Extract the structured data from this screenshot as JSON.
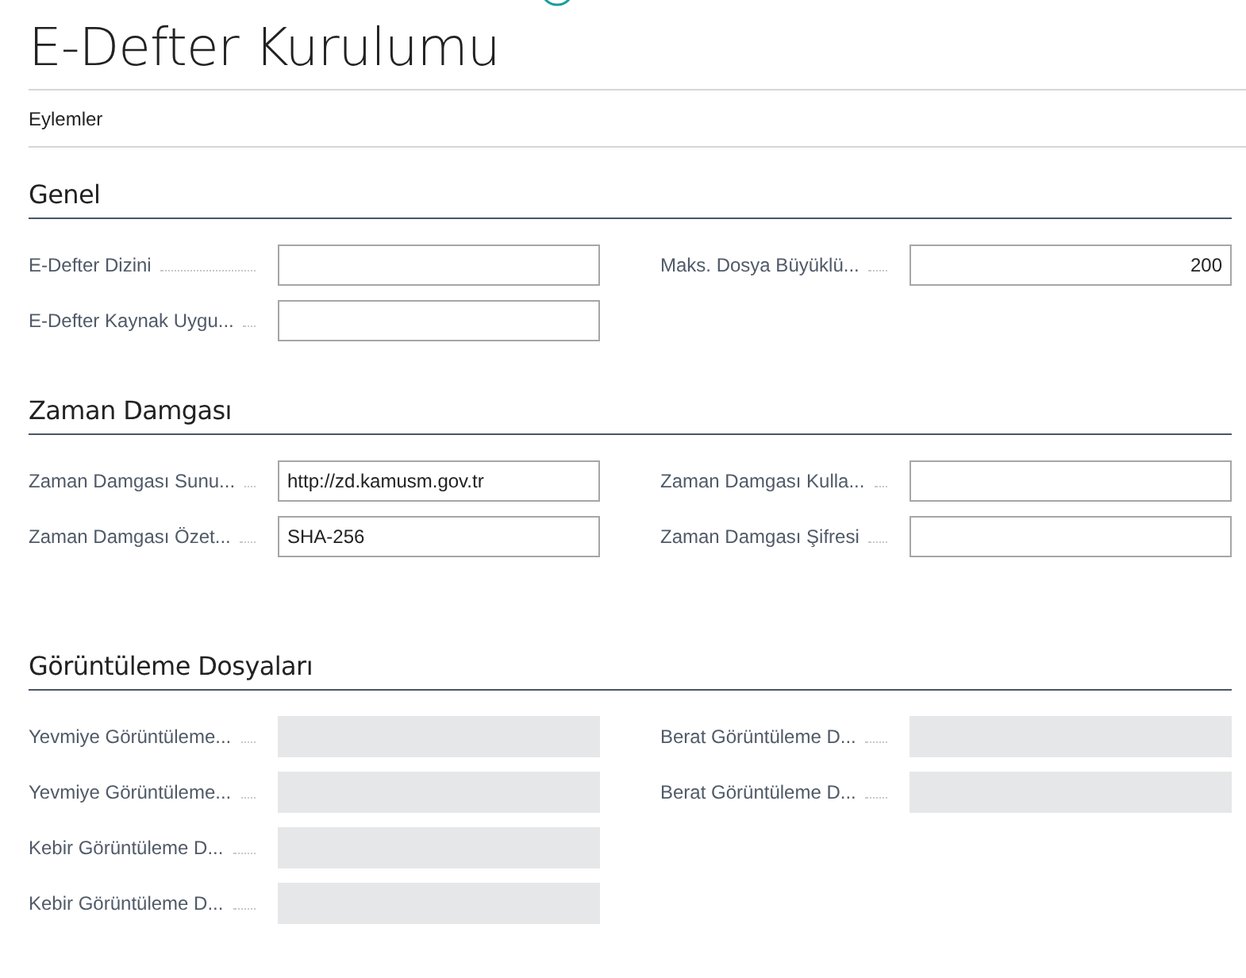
{
  "page": {
    "title": "E-Defter Kurulumu",
    "actions_label": "Eylemler"
  },
  "sections": [
    {
      "title": "Genel",
      "left": [
        {
          "label": "E-Defter Dizini",
          "disabled": false
        },
        {
          "label": "E-Defter Kaynak Uygu...",
          "disabled": false
        }
      ],
      "right": [
        {
          "label": "Maks. Dosya Büyüklü...",
          "value": "200",
          "disabled": false,
          "kind": "number"
        }
      ]
    },
    {
      "title": "Zaman Damgası",
      "left": [
        {
          "label": "Zaman Damgası Sunu...",
          "value": "http://zd.kamusm.gov.tr",
          "disabled": false,
          "kind": "text"
        },
        {
          "label": "Zaman Damgası Özet...",
          "value": "SHA-256",
          "disabled": false,
          "kind": "text"
        }
      ],
      "right": [
        {
          "label": "Zaman Damgası Kulla...",
          "disabled": false
        },
        {
          "label": "Zaman Damgası Şifresi",
          "disabled": false
        }
      ]
    },
    {
      "title": "Görüntüleme Dosyaları",
      "left": [
        {
          "label": "Yevmiye Görüntüleme...",
          "disabled": true
        },
        {
          "label": "Yevmiye Görüntüleme...",
          "disabled": true
        },
        {
          "label": "Kebir Görüntüleme D...",
          "disabled": true
        },
        {
          "label": "Kebir Görüntüleme D...",
          "disabled": true
        }
      ],
      "right": [
        {
          "label": "Berat Görüntüleme D...",
          "disabled": true
        },
        {
          "label": "Berat Görüntüleme D...",
          "disabled": true
        }
      ]
    }
  ]
}
